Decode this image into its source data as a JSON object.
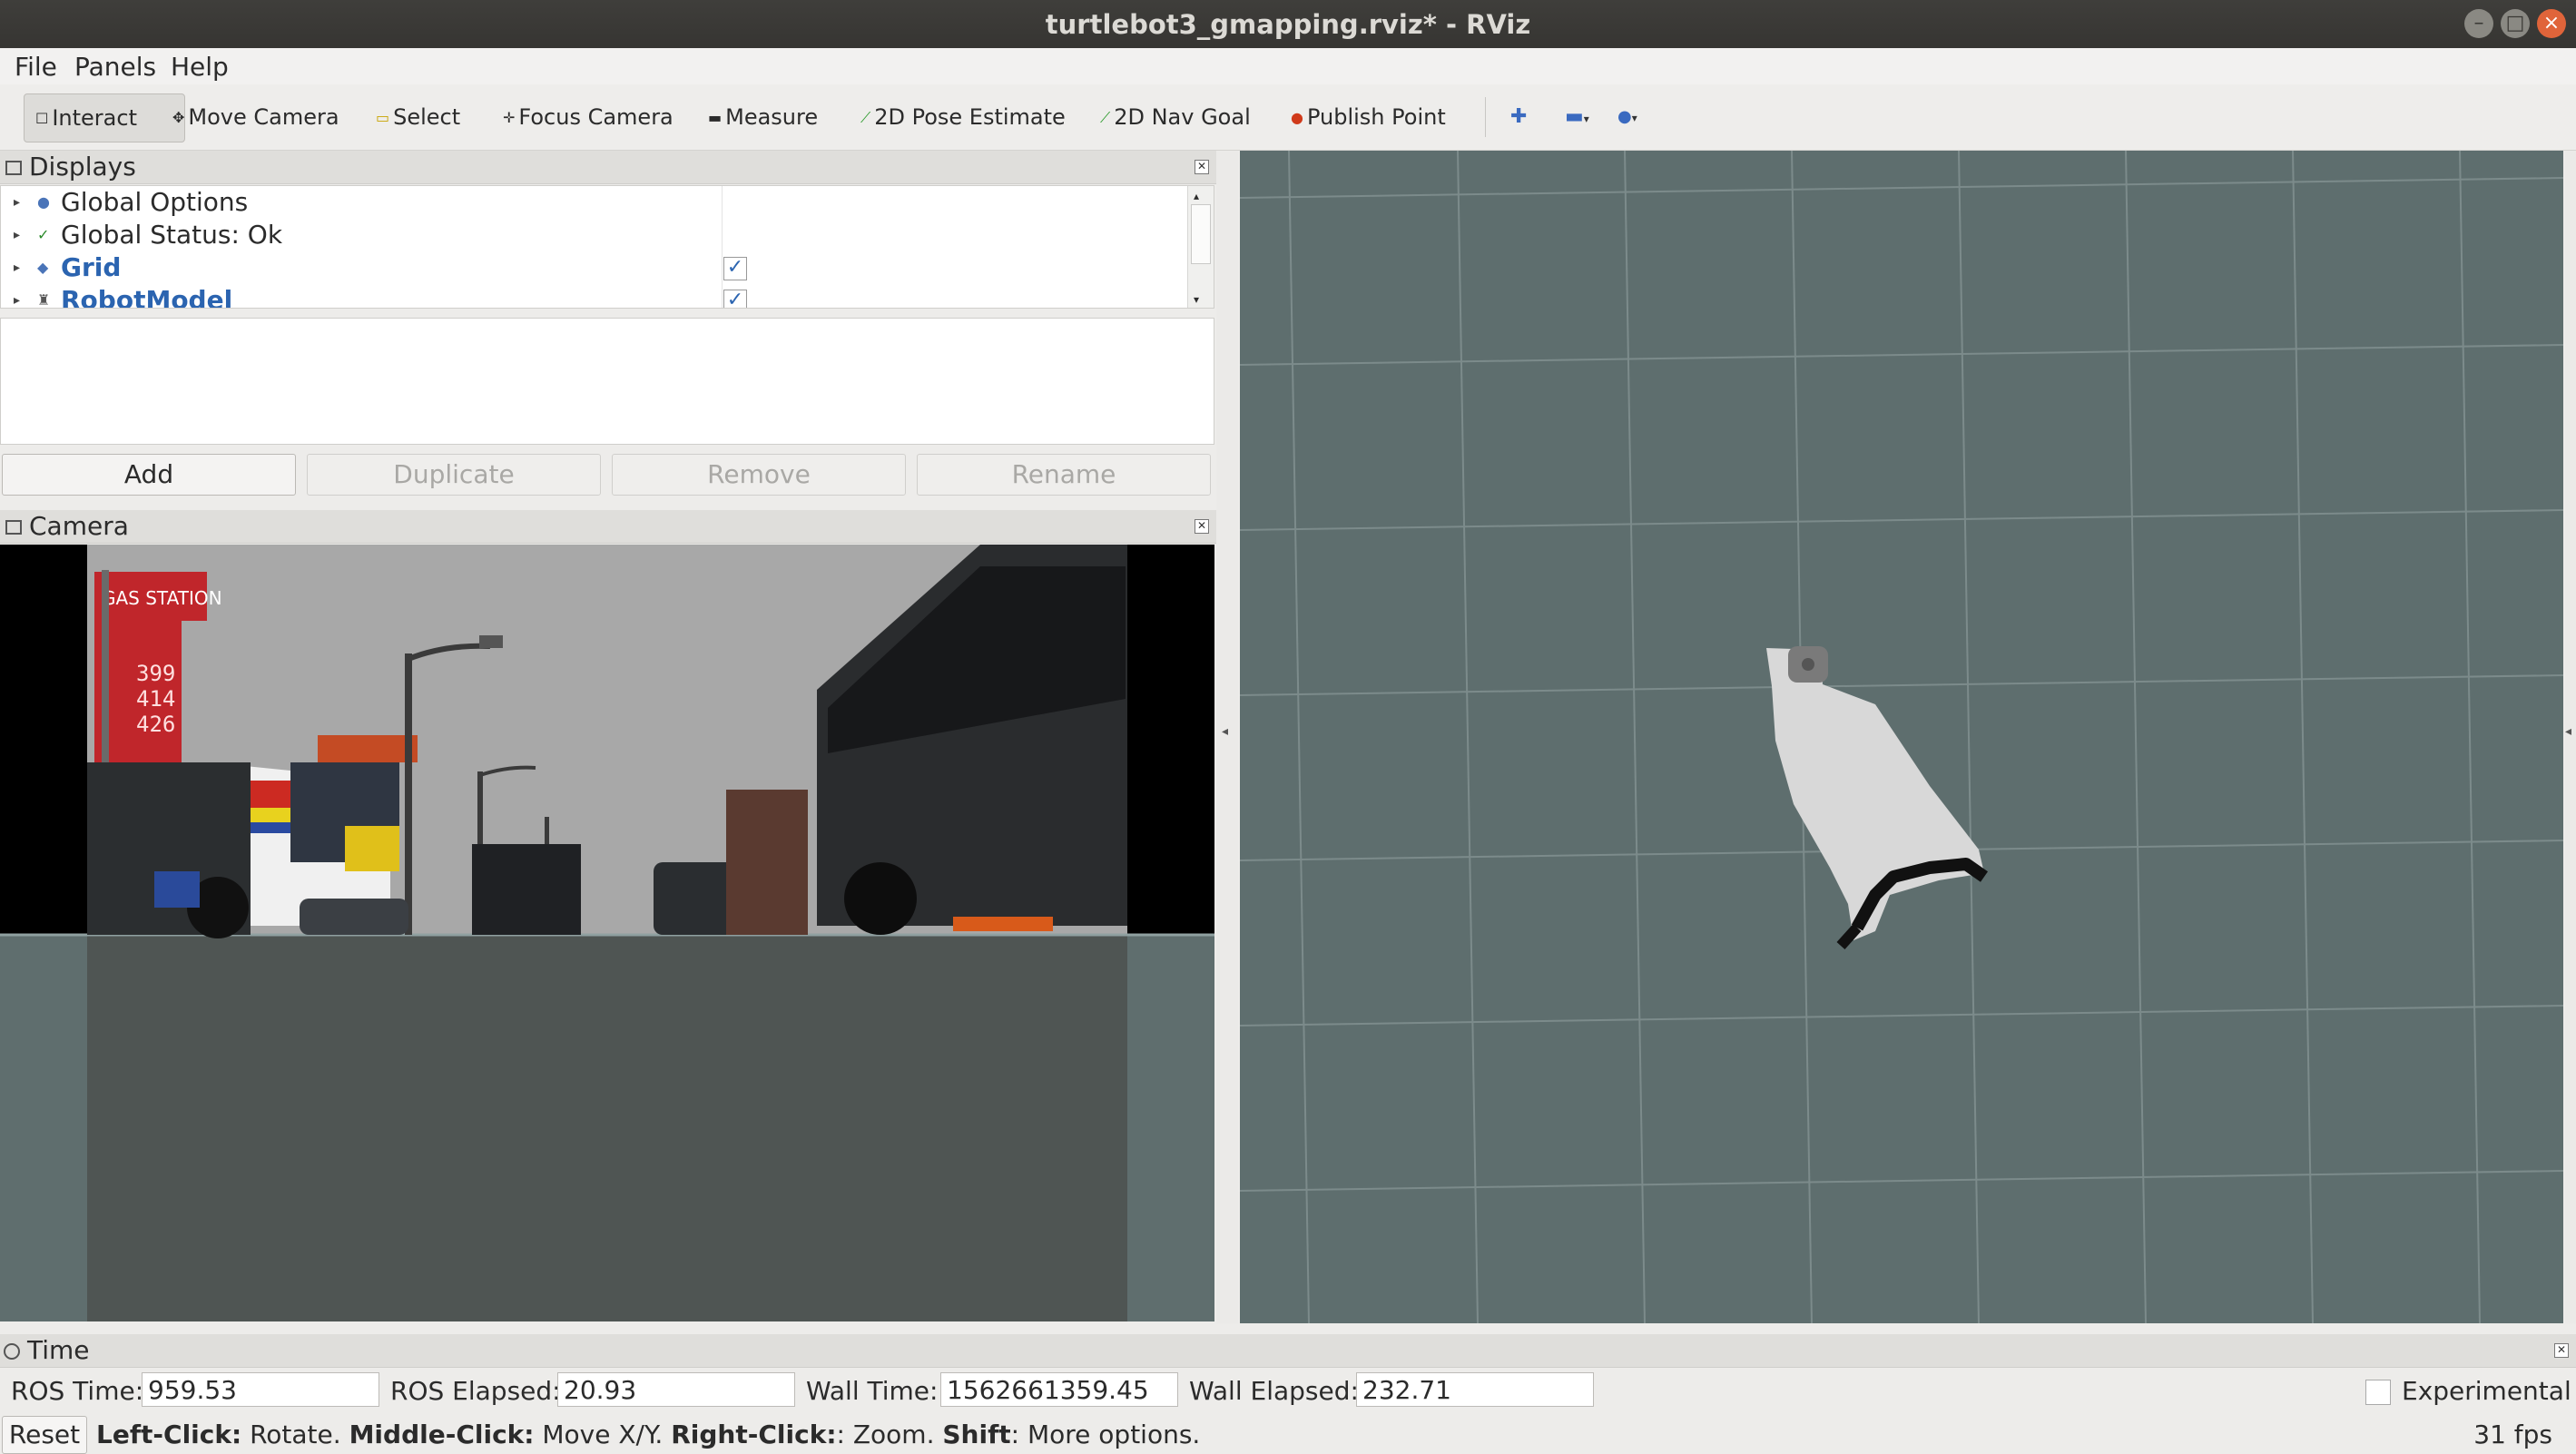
{
  "window": {
    "title": "turtlebot3_gmapping.rviz* - RViz"
  },
  "menubar": {
    "file": "File",
    "panels": "Panels",
    "help": "Help"
  },
  "toolbar": {
    "interact": "Interact",
    "move_camera": "Move Camera",
    "select": "Select",
    "focus_camera": "Focus Camera",
    "measure": "Measure",
    "pose_estimate": "2D Pose Estimate",
    "nav_goal": "2D Nav Goal",
    "publish_point": "Publish Point"
  },
  "displays": {
    "title": "Displays",
    "items": [
      {
        "label": "Global Options",
        "checked": null,
        "enabled": false
      },
      {
        "label": "Global Status: Ok",
        "checked": null,
        "enabled": false
      },
      {
        "label": "Grid",
        "checked": true,
        "enabled": true
      },
      {
        "label": "RobotModel",
        "checked": true,
        "enabled": true
      }
    ],
    "buttons": {
      "add": "Add",
      "duplicate": "Duplicate",
      "remove": "Remove",
      "rename": "Rename"
    }
  },
  "camera": {
    "title": "Camera",
    "sign_text": "GAS STATION",
    "prices": [
      "399",
      "414",
      "426"
    ]
  },
  "time": {
    "title": "Time",
    "ros_time_label": "ROS Time:",
    "ros_time": "959.53",
    "ros_elapsed_label": "ROS Elapsed:",
    "ros_elapsed": "20.93",
    "wall_time_label": "Wall Time:",
    "wall_time": "1562661359.45",
    "wall_elapsed_label": "Wall Elapsed:",
    "wall_elapsed": "232.71",
    "experimental_label": "Experimental",
    "experimental_checked": false
  },
  "status": {
    "reset": "Reset",
    "left_click_key": "Left-Click:",
    "left_click_desc": " Rotate. ",
    "middle_click_key": "Middle-Click:",
    "middle_click_desc": " Move X/Y. ",
    "right_click_key": "Right-Click:",
    "right_click_desc": ": Zoom. ",
    "shift_key": "Shift",
    "shift_desc": ": More options.",
    "fps": "31 fps"
  },
  "colors": {
    "view_bg": "#5e6e6e",
    "grid_line": "#7c8b8b",
    "map_free": "#d8d8d8",
    "map_occupied": "#111111",
    "link_blue": "#2b64b0"
  }
}
